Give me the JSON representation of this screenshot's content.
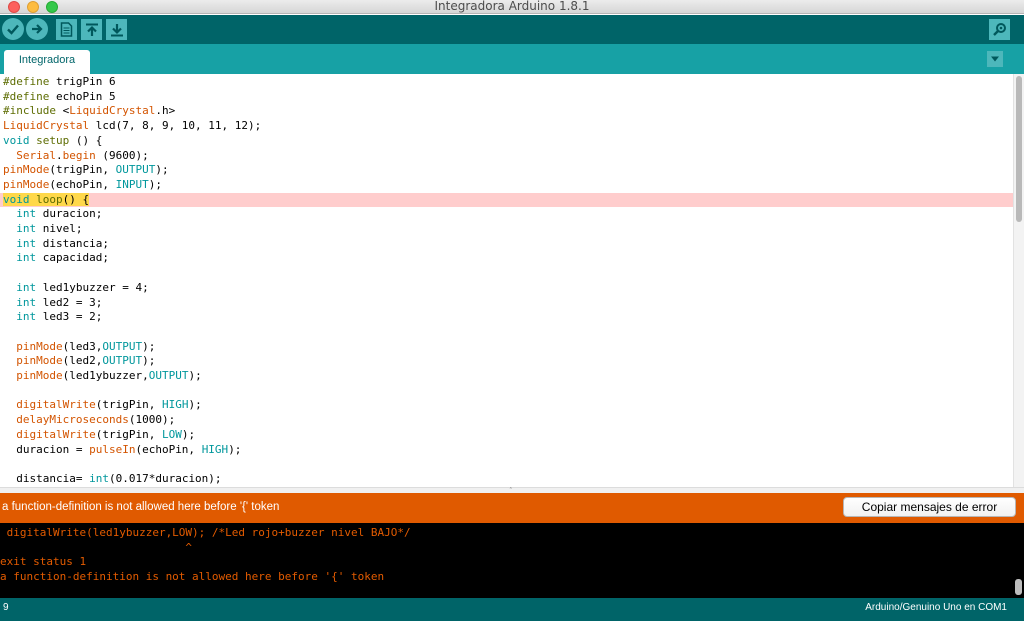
{
  "window": {
    "title": "Integradora Arduino 1.8.1"
  },
  "toolbar": {
    "buttons": [
      {
        "name": "verify",
        "icon": "check-icon"
      },
      {
        "name": "upload",
        "icon": "arrow-right-icon"
      },
      {
        "name": "new",
        "icon": "new-file-icon"
      },
      {
        "name": "open",
        "icon": "arrow-up-icon"
      },
      {
        "name": "save",
        "icon": "arrow-down-icon"
      },
      {
        "name": "serial-monitor",
        "icon": "magnifier-icon"
      }
    ]
  },
  "tabs": [
    {
      "label": "Integradora",
      "active": true
    }
  ],
  "editor": {
    "lines": [
      [
        {
          "t": "#define",
          "c": "kw"
        },
        {
          "t": " trigPin 6",
          "c": "tx"
        }
      ],
      [
        {
          "t": "#define",
          "c": "kw"
        },
        {
          "t": " echoPin 5",
          "c": "tx"
        }
      ],
      [
        {
          "t": "#include",
          "c": "kw"
        },
        {
          "t": " <",
          "c": "tx"
        },
        {
          "t": "LiquidCrystal",
          "c": "fn"
        },
        {
          "t": ".h>",
          "c": "tx"
        }
      ],
      [
        {
          "t": "LiquidCrystal",
          "c": "fn"
        },
        {
          "t": " lcd(7, 8, 9, 10, 11, 12);",
          "c": "tx"
        }
      ],
      [
        {
          "t": "void",
          "c": "kw2"
        },
        {
          "t": " ",
          "c": "tx"
        },
        {
          "t": "setup",
          "c": "kw"
        },
        {
          "t": " () {",
          "c": "tx"
        }
      ],
      [
        {
          "t": "  ",
          "c": "tx"
        },
        {
          "t": "Serial",
          "c": "fn"
        },
        {
          "t": ".",
          "c": "tx"
        },
        {
          "t": "begin",
          "c": "fn"
        },
        {
          "t": " (9600);",
          "c": "tx"
        }
      ],
      [
        {
          "t": "pinMode",
          "c": "fn"
        },
        {
          "t": "(trigPin, ",
          "c": "tx"
        },
        {
          "t": "OUTPUT",
          "c": "kw2"
        },
        {
          "t": ");",
          "c": "tx"
        }
      ],
      [
        {
          "t": "pinMode",
          "c": "fn"
        },
        {
          "t": "(echoPin, ",
          "c": "tx"
        },
        {
          "t": "INPUT",
          "c": "kw2"
        },
        {
          "t": ");",
          "c": "tx"
        }
      ],
      [
        {
          "t": "void",
          "c": "kw2"
        },
        {
          "t": " ",
          "c": "tx"
        },
        {
          "t": "loop",
          "c": "kw"
        },
        {
          "t": "() {",
          "c": "tx"
        }
      ],
      [
        {
          "t": "  ",
          "c": "tx"
        },
        {
          "t": "int",
          "c": "kw2"
        },
        {
          "t": " duracion;",
          "c": "tx"
        }
      ],
      [
        {
          "t": "  ",
          "c": "tx"
        },
        {
          "t": "int",
          "c": "kw2"
        },
        {
          "t": " nivel;",
          "c": "tx"
        }
      ],
      [
        {
          "t": "  ",
          "c": "tx"
        },
        {
          "t": "int",
          "c": "kw2"
        },
        {
          "t": " distancia;",
          "c": "tx"
        }
      ],
      [
        {
          "t": "  ",
          "c": "tx"
        },
        {
          "t": "int",
          "c": "kw2"
        },
        {
          "t": " capacidad;",
          "c": "tx"
        }
      ],
      [],
      [
        {
          "t": "  ",
          "c": "tx"
        },
        {
          "t": "int",
          "c": "kw2"
        },
        {
          "t": " led1ybuzzer = 4;",
          "c": "tx"
        }
      ],
      [
        {
          "t": "  ",
          "c": "tx"
        },
        {
          "t": "int",
          "c": "kw2"
        },
        {
          "t": " led2 = 3;",
          "c": "tx"
        }
      ],
      [
        {
          "t": "  ",
          "c": "tx"
        },
        {
          "t": "int",
          "c": "kw2"
        },
        {
          "t": " led3 = 2;",
          "c": "tx"
        }
      ],
      [],
      [
        {
          "t": "  ",
          "c": "tx"
        },
        {
          "t": "pinMode",
          "c": "fn"
        },
        {
          "t": "(led3,",
          "c": "tx"
        },
        {
          "t": "OUTPUT",
          "c": "kw2"
        },
        {
          "t": ");",
          "c": "tx"
        }
      ],
      [
        {
          "t": "  ",
          "c": "tx"
        },
        {
          "t": "pinMode",
          "c": "fn"
        },
        {
          "t": "(led2,",
          "c": "tx"
        },
        {
          "t": "OUTPUT",
          "c": "kw2"
        },
        {
          "t": ");",
          "c": "tx"
        }
      ],
      [
        {
          "t": "  ",
          "c": "tx"
        },
        {
          "t": "pinMode",
          "c": "fn"
        },
        {
          "t": "(led1ybuzzer,",
          "c": "tx"
        },
        {
          "t": "OUTPUT",
          "c": "kw2"
        },
        {
          "t": ");",
          "c": "tx"
        }
      ],
      [],
      [
        {
          "t": "  ",
          "c": "tx"
        },
        {
          "t": "digitalWrite",
          "c": "fn"
        },
        {
          "t": "(trigPin, ",
          "c": "tx"
        },
        {
          "t": "HIGH",
          "c": "kw2"
        },
        {
          "t": ");",
          "c": "tx"
        }
      ],
      [
        {
          "t": "  ",
          "c": "tx"
        },
        {
          "t": "delayMicroseconds",
          "c": "fn"
        },
        {
          "t": "(1000);",
          "c": "tx"
        }
      ],
      [
        {
          "t": "  ",
          "c": "tx"
        },
        {
          "t": "digitalWrite",
          "c": "fn"
        },
        {
          "t": "(trigPin, ",
          "c": "tx"
        },
        {
          "t": "LOW",
          "c": "kw2"
        },
        {
          "t": ");",
          "c": "tx"
        }
      ],
      [
        {
          "t": "  duracion = ",
          "c": "tx"
        },
        {
          "t": "pulseIn",
          "c": "fn"
        },
        {
          "t": "(echoPin, ",
          "c": "tx"
        },
        {
          "t": "HIGH",
          "c": "kw2"
        },
        {
          "t": ");",
          "c": "tx"
        }
      ],
      [],
      [
        {
          "t": "  distancia= ",
          "c": "tx"
        },
        {
          "t": "int",
          "c": "kw2"
        },
        {
          "t": "(0.017*duracion);",
          "c": "tx"
        }
      ]
    ],
    "error_line_index": 8
  },
  "errorbar": {
    "message": "a function-definition is not allowed here before '{' token",
    "copy_button_label": "Copiar mensajes de error"
  },
  "console": {
    "lines": [
      " digitalWrite(led1ybuzzer,LOW); /*Led rojo+buzzer nivel BAJO*/",
      "                            ^",
      "exit status 1",
      "a function-definition is not allowed here before '{' token"
    ]
  },
  "statusbar": {
    "line_number": "9",
    "board": "Arduino/Genuino Uno en COM1"
  },
  "colors": {
    "toolbar": "#006468",
    "tabbar": "#17a1a5",
    "button": "#4db7bb",
    "errorbar": "#e05a00",
    "console_text": "#e35b00",
    "error_line_bg": "#ffcdcd"
  }
}
